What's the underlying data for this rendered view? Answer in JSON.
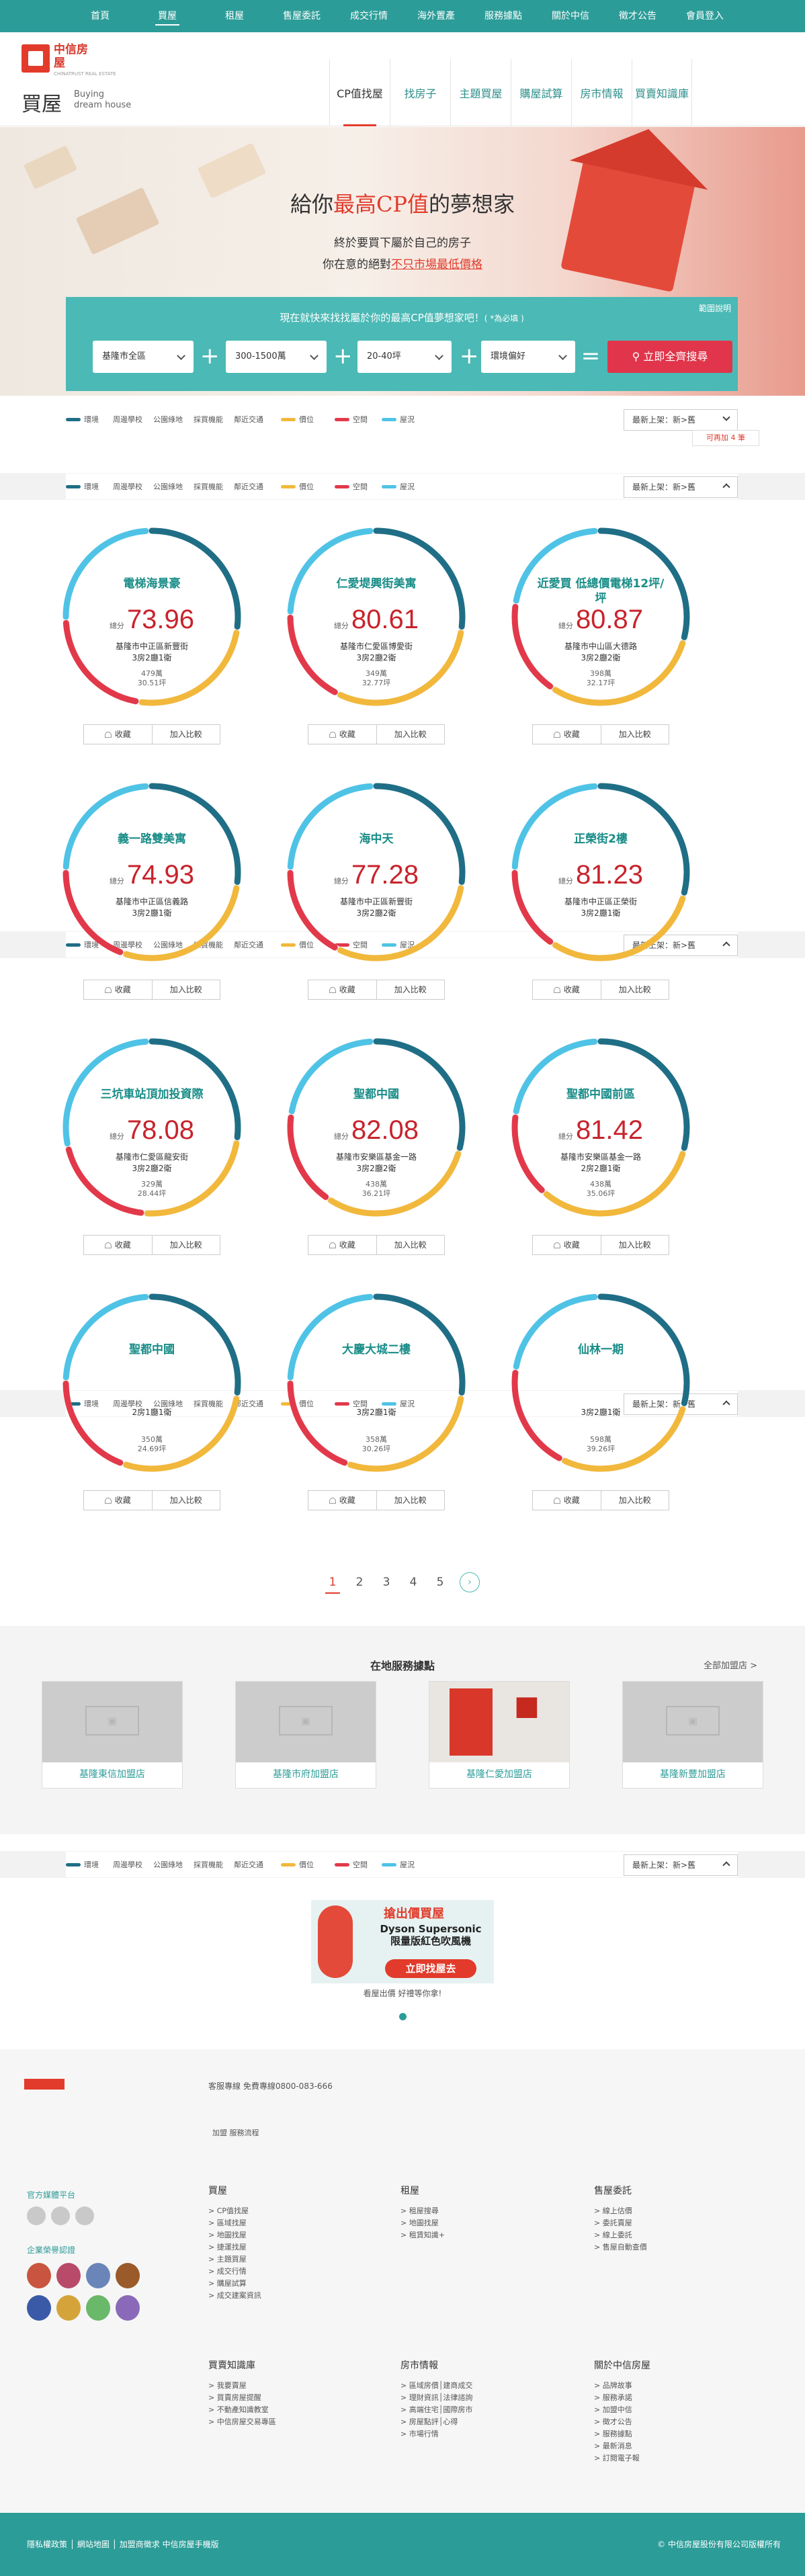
{
  "topnav": [
    "首頁",
    "買屋",
    "租屋",
    "售屋委託",
    "成交行情",
    "海外置產",
    "服務據點",
    "關於中信",
    "徵才公告",
    "會員登入"
  ],
  "brand": {
    "name": "中信房屋",
    "sub": "CHINATRUST REAL ESTATE"
  },
  "page_title": {
    "zh": "買屋",
    "en1": "Buying",
    "en2": "dream house"
  },
  "mainnav": [
    "CP值找屋",
    "找房子",
    "主題買屋",
    "購屋試算",
    "房市情報",
    "買賣知識庫"
  ],
  "hero": {
    "title_pre": "給你",
    "title_hl": "最高CP值",
    "title_post": "的夢想家",
    "line1": "終於要買下屬於自己的房子",
    "line2_pre": "你在意的絕對",
    "line2_link": "不只市場最低價格"
  },
  "search": {
    "title": "現在就快來找找屬於你的最高CP值夢想家吧！",
    "required": "( *為必填 )",
    "help": "範圍說明",
    "selects": [
      "基隆市全區",
      "300-1500萬",
      "20-40坪",
      "環境偏好"
    ],
    "button": "立即全齊搜尋"
  },
  "legend": {
    "items": [
      "環境",
      "周邊學校",
      "公園綠地",
      "採買機能",
      "鄰近交通",
      "價位",
      "空間",
      "屋況"
    ],
    "colors": {
      "env": "#1f6e86",
      "price": "#f1b83c",
      "space": "#e2394a",
      "cond": "#4fc3e6"
    },
    "sort": "最新上架：新>舊"
  },
  "compare_tip": "可再加 4 筆",
  "cards": [
    {
      "name": "電梯海景豪",
      "score": "73.96",
      "addr": "基隆市中正區新豐街",
      "rooms": "3房2廳1衛",
      "price": "479萬",
      "size": "30.51坪",
      "segs": [
        0.28,
        0.25,
        0.22,
        0.25
      ]
    },
    {
      "name": "仁愛堤興街美寓",
      "score": "80.61",
      "addr": "基隆市仁愛區博愛街",
      "rooms": "3房2廳2衛",
      "price": "349萬",
      "size": "32.77坪",
      "segs": [
        0.28,
        0.3,
        0.18,
        0.24
      ]
    },
    {
      "name": "近愛買 低總價電梯12坪/坪",
      "score": "80.87",
      "addr": "基隆市中山區大德路",
      "rooms": "3房2廳2衛",
      "price": "398萬",
      "size": "32.17坪",
      "segs": [
        0.3,
        0.3,
        0.18,
        0.22
      ]
    },
    {
      "name": "義一路雙美寓",
      "score": "74.93",
      "addr": "基隆市中正區信義路",
      "rooms": "3房2廳1衛",
      "price": "",
      "size": "",
      "segs": [
        0.28,
        0.28,
        0.2,
        0.24
      ]
    },
    {
      "name": "海中天",
      "score": "77.28",
      "addr": "基隆市中正區新豐街",
      "rooms": "3房2廳2衛",
      "price": "",
      "size": "",
      "segs": [
        0.28,
        0.3,
        0.18,
        0.24
      ]
    },
    {
      "name": "正榮街2樓",
      "score": "81.23",
      "addr": "基隆市中正區正榮街",
      "rooms": "3房2廳1衛",
      "price": "",
      "size": "",
      "segs": [
        0.3,
        0.3,
        0.16,
        0.24
      ]
    },
    {
      "name": "三坑車站頂加投資際",
      "score": "78.08",
      "addr": "基隆市仁愛區龍安街",
      "rooms": "3房2廳2衛",
      "price": "329萬",
      "size": "28.44坪",
      "segs": [
        0.28,
        0.24,
        0.2,
        0.28
      ]
    },
    {
      "name": "聖都中國",
      "score": "82.08",
      "addr": "基隆市安樂區基金一路",
      "rooms": "3房2廳2衛",
      "price": "438萬",
      "size": "36.21坪",
      "segs": [
        0.3,
        0.3,
        0.18,
        0.22
      ]
    },
    {
      "name": "聖都中國前區",
      "score": "81.42",
      "addr": "基隆市安樂區基金一路",
      "rooms": "2房2廳1衛",
      "price": "438萬",
      "size": "35.06坪",
      "segs": [
        0.3,
        0.32,
        0.16,
        0.22
      ]
    },
    {
      "name": "聖都中國",
      "score": "",
      "addr": "",
      "rooms": "2房1廳1衛",
      "price": "350萬",
      "size": "24.69坪",
      "segs": [
        0.28,
        0.28,
        0.2,
        0.24
      ]
    },
    {
      "name": "大慶大城二樓",
      "score": "",
      "addr": "",
      "rooms": "3房2廳1衛",
      "price": "358萬",
      "size": "30.26坪",
      "segs": [
        0.28,
        0.28,
        0.2,
        0.24
      ]
    },
    {
      "name": "仙林一期",
      "score": "",
      "addr": "",
      "rooms": "3房2廳1衛",
      "price": "598萬",
      "size": "39.26坪",
      "segs": [
        0.3,
        0.28,
        0.2,
        0.22
      ]
    }
  ],
  "card_actions": {
    "fav": "收藏",
    "compare": "加入比較"
  },
  "score_label": "總分",
  "pager": [
    "1",
    "2",
    "3",
    "4",
    "5"
  ],
  "stores": {
    "title": "在地服務據點",
    "all": "全部加盟店 >",
    "items": [
      "基隆東信加盟店",
      "基隆市府加盟店",
      "基隆仁愛加盟店",
      "基隆新豐加盟店"
    ]
  },
  "banner": {
    "tag": "搶出價買屋",
    "line1": "Dyson Supersonic",
    "line2": "限量版紅色吹風機",
    "cta": "立即找屋去",
    "caption": "看屋出價 好禮等你拿!"
  },
  "footer": {
    "service": "客服專線 免費專線0800-083-666",
    "sub": "加盟 服務流程",
    "platform": "官方媒體平台",
    "certs": "企業榮譽認證",
    "cols": [
      {
        "title": "買屋",
        "links": [
          "CP值找屋",
          "區域找屋",
          "地圖找屋",
          "捷運找屋",
          "主題買屋",
          "成交行情",
          "購屋試算",
          "成交建案資訊"
        ]
      },
      {
        "title": "租屋",
        "links": [
          "租屋搜尋",
          "地圖找屋",
          "租賃知識+"
        ]
      },
      {
        "title": "售屋委託",
        "links": [
          "線上估價",
          "委託賣屋",
          "線上委託",
          "售屋自動查價"
        ]
      },
      {
        "title": "買賣知識庫",
        "links": [
          "我要賣屋",
          "買賣房屋提醒",
          "不動產知識教室",
          "中信房屋交易專區"
        ]
      },
      {
        "title": "房市情報",
        "links": [
          "區域房價│建商成交",
          "理財資訊│法律諮詢",
          "高端住宅│國際房市",
          "房屋點評│心得",
          "市場行情"
        ]
      },
      {
        "title": "關於中信房屋",
        "links": [
          "品牌故事",
          "服務承諾",
          "加盟中信",
          "徵才公告",
          "服務據點",
          "最新消息",
          "訂閱電子報"
        ]
      }
    ],
    "bar_left": [
      "隱私權政策",
      "網站地圖",
      "加盟商徵求",
      "中信房屋手機版"
    ],
    "copyright": "© 中信房屋股份有限公司版權所有"
  }
}
